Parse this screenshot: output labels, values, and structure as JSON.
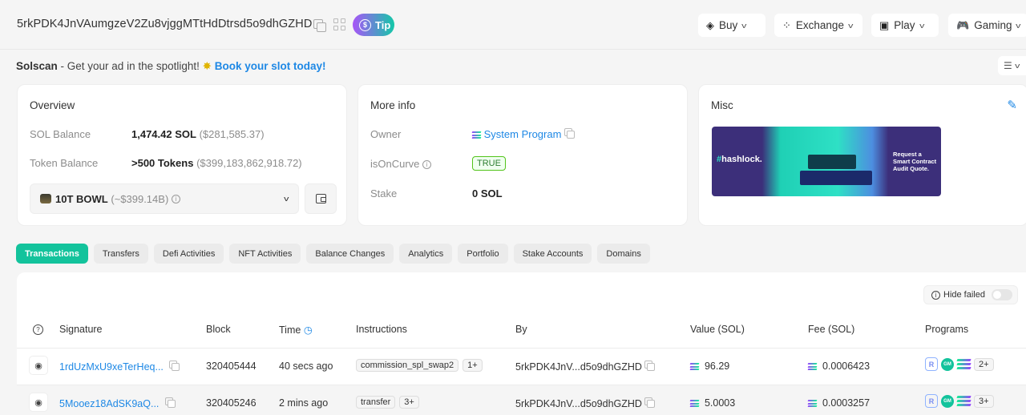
{
  "header": {
    "address": "5rkPDK4JnVAumgzeV2Zu8vjggMTtHdDtrsd5o9dhGZHD",
    "tip_label": "Tip",
    "nav": [
      {
        "label": "Buy",
        "icon": "buy-icon"
      },
      {
        "label": "Exchange",
        "icon": "exchange-icon"
      },
      {
        "label": "Play",
        "icon": "play-icon"
      },
      {
        "label": "Gaming",
        "icon": "gamepad-icon"
      }
    ]
  },
  "ad": {
    "brand": "Solscan",
    "text": " - Get your ad in the spotlight! ",
    "link": "Book your slot today!"
  },
  "overview": {
    "title": "Overview",
    "sol_balance_label": "SOL Balance",
    "sol_balance": "1,474.42 SOL",
    "sol_balance_usd": "($281,585.37)",
    "token_balance_label": "Token Balance",
    "token_balance": ">500 Tokens",
    "token_balance_usd": "($399,183,862,918.72)",
    "selected_token": "10T BOWL",
    "selected_token_value": "(~$399.14B)"
  },
  "more_info": {
    "title": "More info",
    "owner_label": "Owner",
    "owner": "System Program",
    "is_on_curve_label": "isOnCurve",
    "is_on_curve": "TRUE",
    "stake_label": "Stake",
    "stake": "0 SOL"
  },
  "misc": {
    "title": "Misc",
    "banner_brand": "hashlock.",
    "banner_cta": [
      "Request a",
      "Smart Contract",
      "Audit Quote."
    ]
  },
  "tabs": [
    "Transactions",
    "Transfers",
    "Defi Activities",
    "NFT Activities",
    "Balance Changes",
    "Analytics",
    "Portfolio",
    "Stake Accounts",
    "Domains"
  ],
  "active_tab": "Transactions",
  "table": {
    "hide_failed_label": "Hide failed",
    "hide_failed": false,
    "columns": [
      "Signature",
      "Block",
      "Time",
      "Instructions",
      "By",
      "Value (SOL)",
      "Fee (SOL)",
      "Programs"
    ],
    "rows": [
      {
        "signature": "1rdUzMxU9xeTerHeq...",
        "block": "320405444",
        "time": "40 secs ago",
        "instruction": "commission_spl_swap2",
        "more": "1+",
        "by": "5rkPDK4JnV...d5o9dhGZHD",
        "value": "96.29",
        "fee": "0.0006423",
        "programs_more": "2+"
      },
      {
        "signature": "5Mooez18AdSK9aQ...",
        "block": "320405246",
        "time": "2 mins ago",
        "instruction": "transfer",
        "more": "3+",
        "by": "5rkPDK4JnV...d5o9dhGZHD",
        "value": "5.0003",
        "fee": "0.0003257",
        "programs_more": "3+"
      }
    ]
  },
  "colors": {
    "accent": "#13c39c",
    "link": "#1e88e5",
    "background": "#f5f5f5"
  }
}
